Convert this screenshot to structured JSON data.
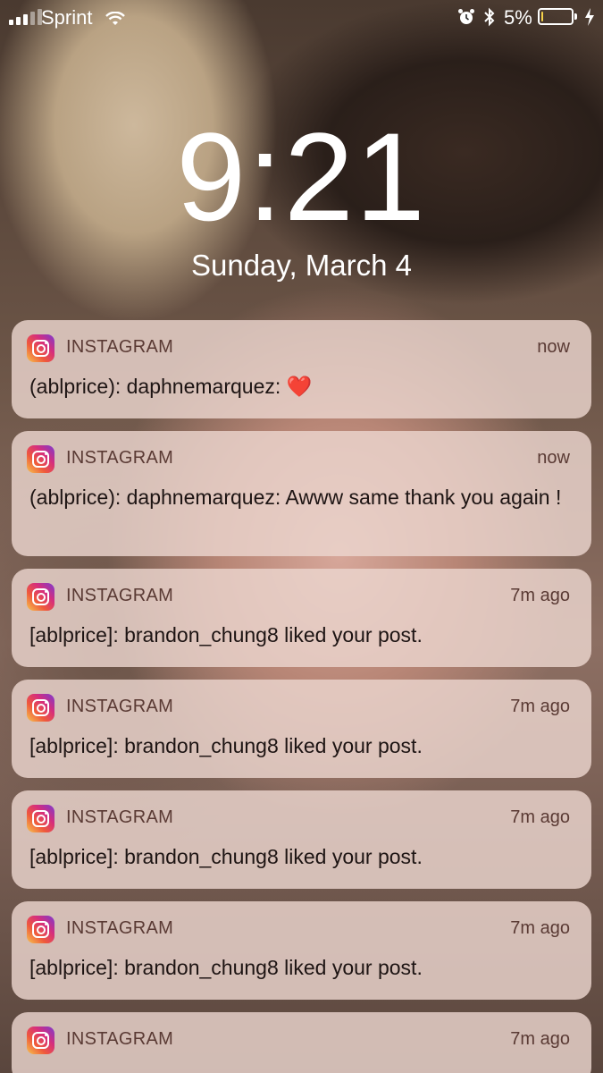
{
  "status_bar": {
    "carrier": "Sprint",
    "battery_percent": "5%",
    "battery_level": 0.05
  },
  "lock_screen": {
    "time": "9:21",
    "date": "Sunday, March 4"
  },
  "notifications": [
    {
      "app": "INSTAGRAM",
      "time": "now",
      "message": "(ablprice): daphnemarquez:",
      "emoji": "❤️"
    },
    {
      "app": "INSTAGRAM",
      "time": "now",
      "message": "(ablprice): daphnemarquez: Awww same thank you again !"
    },
    {
      "app": "INSTAGRAM",
      "time": "7m ago",
      "message": "[ablprice]: brandon_chung8 liked your post."
    },
    {
      "app": "INSTAGRAM",
      "time": "7m ago",
      "message": "[ablprice]: brandon_chung8 liked your post."
    },
    {
      "app": "INSTAGRAM",
      "time": "7m ago",
      "message": "[ablprice]: brandon_chung8 liked your post."
    },
    {
      "app": "INSTAGRAM",
      "time": "7m ago",
      "message": "[ablprice]: brandon_chung8 liked your post."
    },
    {
      "app": "INSTAGRAM",
      "time": "7m ago",
      "message": ""
    }
  ],
  "icons": {
    "app_icon": "instagram-icon",
    "status": [
      "signal-icon",
      "wifi-icon",
      "alarm-icon",
      "bluetooth-icon",
      "battery-icon",
      "charging-icon"
    ]
  },
  "colors": {
    "battery_low": "#f6d24a",
    "heart": "#e2232e"
  }
}
